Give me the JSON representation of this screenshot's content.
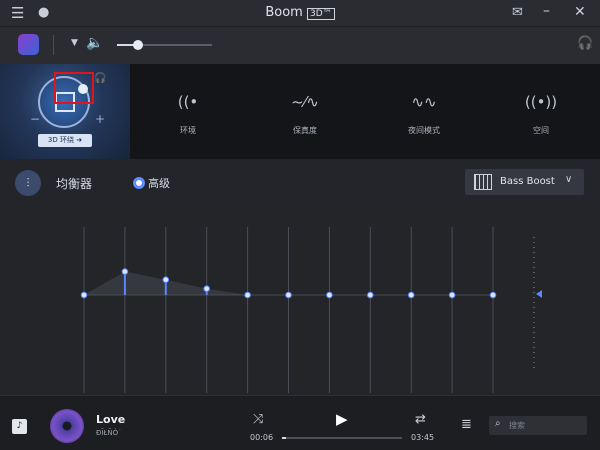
{
  "app": {
    "title": "Boom",
    "title_badge": "3D™"
  },
  "toolbar": {
    "volume_level": 0.22
  },
  "surround": {
    "label": "3D 环绕 ➜",
    "minus": "−",
    "plus": "+"
  },
  "effects": [
    {
      "id": "ambience",
      "label": "环境",
      "icon": "ambience-icon"
    },
    {
      "id": "fidelity",
      "label": "保真度",
      "icon": "fidelity-icon"
    },
    {
      "id": "night",
      "label": "夜间模式",
      "icon": "night-mode-icon"
    },
    {
      "id": "space",
      "label": "空间",
      "icon": "space-icon"
    }
  ],
  "equalizer": {
    "title": "均衡器",
    "mode_label": "高级",
    "preset": "Bass Boost",
    "bands": [
      0,
      0.26,
      0.17,
      0.07,
      0,
      0,
      0,
      0,
      0,
      0,
      0
    ]
  },
  "player": {
    "song_title": "Love",
    "artist": "ÐĪŁÑÒ˙",
    "elapsed": "00:06",
    "total": "03:45",
    "progress": 0.03,
    "search_placeholder": "搜索"
  },
  "colors": {
    "accent": "#5b86ff",
    "panel": "#141518",
    "bg": "#232529"
  }
}
